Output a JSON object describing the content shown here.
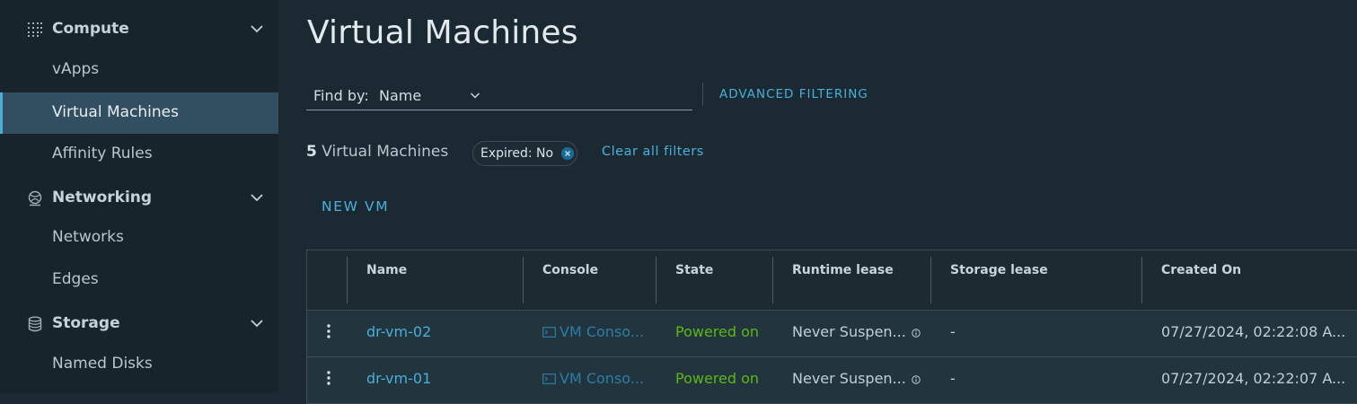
{
  "sidebar": {
    "groups": [
      {
        "label": "Compute",
        "icon": "grid-dots-icon"
      },
      {
        "label": "Networking",
        "icon": "network-globe-icon"
      },
      {
        "label": "Storage",
        "icon": "database-icon"
      }
    ],
    "items": {
      "vapps": "vApps",
      "virtual_machines": "Virtual Machines",
      "affinity_rules": "Affinity Rules",
      "networks": "Networks",
      "edges": "Edges",
      "named_disks": "Named Disks"
    },
    "active_item": "Virtual Machines"
  },
  "main": {
    "title": "Virtual Machines",
    "find_by": {
      "label": "Find by:",
      "value": "Name"
    },
    "advanced_filtering": "ADVANCED FILTERING",
    "count": "5",
    "count_label": "Virtual Machines",
    "filter_chip": {
      "key": "Expired:",
      "value": "No"
    },
    "clear_filters": "Clear all filters",
    "new_vm": "NEW VM"
  },
  "table": {
    "columns": [
      "Name",
      "Console",
      "State",
      "Runtime lease",
      "Storage lease",
      "Created On"
    ],
    "rows": [
      {
        "name": "dr-vm-02",
        "console": "VM Conso...",
        "state": "Powered on",
        "runtime_lease": "Never Suspen...",
        "storage_lease": "-",
        "created_on": "07/27/2024, 02:22:08 A..."
      },
      {
        "name": "dr-vm-01",
        "console": "VM Conso...",
        "state": "Powered on",
        "runtime_lease": "Never Suspen...",
        "storage_lease": "-",
        "created_on": "07/27/2024, 02:22:07 A..."
      }
    ]
  },
  "colors": {
    "accent": "#49afd9",
    "powered_on": "#5eb715",
    "sidebar_bg": "#17242b",
    "main_bg": "#1b2a32",
    "active_bg": "#324f61"
  }
}
